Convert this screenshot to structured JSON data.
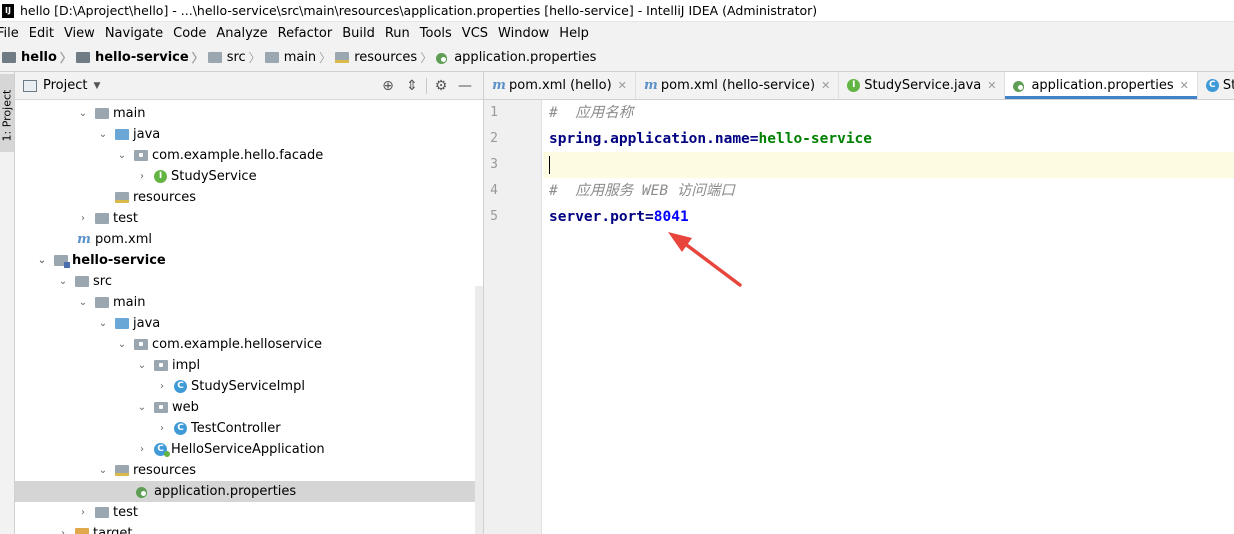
{
  "window": {
    "title": "hello [D:\\Aproject\\hello] - ...\\hello-service\\src\\main\\resources\\application.properties [hello-service] - IntelliJ IDEA (Administrator)"
  },
  "menu": [
    "File",
    "Edit",
    "View",
    "Navigate",
    "Code",
    "Analyze",
    "Refactor",
    "Build",
    "Run",
    "Tools",
    "VCS",
    "Window",
    "Help"
  ],
  "breadcrumb": [
    "hello",
    "hello-service",
    "src",
    "main",
    "resources",
    "application.properties"
  ],
  "tool_stripe": {
    "label": "1: Project"
  },
  "project_panel": {
    "title": "Project",
    "tree": [
      {
        "label": "main",
        "icon": "folder-icon",
        "expanded": true
      },
      {
        "label": "java",
        "icon": "source-folder-icon",
        "expanded": true
      },
      {
        "label": "com.example.hello.facade",
        "icon": "package-icon",
        "expanded": true
      },
      {
        "label": "StudyService",
        "icon": "interface-icon",
        "expanded": false
      },
      {
        "label": "resources",
        "icon": "resources-folder-icon"
      },
      {
        "label": "test",
        "icon": "folder-icon",
        "expanded": false
      },
      {
        "label": "pom.xml",
        "icon": "maven-icon"
      },
      {
        "label": "hello-service",
        "icon": "module-icon",
        "expanded": true,
        "bold": true
      },
      {
        "label": "src",
        "icon": "folder-icon",
        "expanded": true
      },
      {
        "label": "main",
        "icon": "folder-icon",
        "expanded": true
      },
      {
        "label": "java",
        "icon": "source-folder-icon",
        "expanded": true
      },
      {
        "label": "com.example.helloservice",
        "icon": "package-icon",
        "expanded": true
      },
      {
        "label": "impl",
        "icon": "package-icon",
        "expanded": true
      },
      {
        "label": "StudyServiceImpl",
        "icon": "class-icon",
        "expanded": false
      },
      {
        "label": "web",
        "icon": "package-icon",
        "expanded": true
      },
      {
        "label": "TestController",
        "icon": "class-icon",
        "expanded": false
      },
      {
        "label": "HelloServiceApplication",
        "icon": "spring-app-icon",
        "expanded": false
      },
      {
        "label": "resources",
        "icon": "resources-folder-icon",
        "expanded": true
      },
      {
        "label": "application.properties",
        "icon": "properties-icon",
        "selected": true
      },
      {
        "label": "test",
        "icon": "folder-icon",
        "expanded": false
      },
      {
        "label": "target",
        "icon": "folder-icon",
        "expanded": false
      }
    ]
  },
  "editor": {
    "tabs": [
      {
        "label": "pom.xml (hello)",
        "icon": "maven-icon"
      },
      {
        "label": "pom.xml (hello-service)",
        "icon": "maven-icon"
      },
      {
        "label": "StudyService.java",
        "icon": "interface-icon"
      },
      {
        "label": "application.properties",
        "icon": "properties-icon",
        "active": true
      },
      {
        "label": "StudyServiceImpl",
        "icon": "class-icon"
      }
    ],
    "line_numbers": [
      "1",
      "2",
      "3",
      "4",
      "5"
    ],
    "lines": {
      "l1_comment": "#  应用名称",
      "l2_key": "spring.application.name",
      "l2_eq": "=",
      "l2_value": "hello-service",
      "l4_comment": "#  应用服务 WEB 访问端口",
      "l5_key": "server.port",
      "l5_eq": "=",
      "l5_value": "8041"
    }
  },
  "annotation": {
    "arrow_color": "#e8453c"
  }
}
